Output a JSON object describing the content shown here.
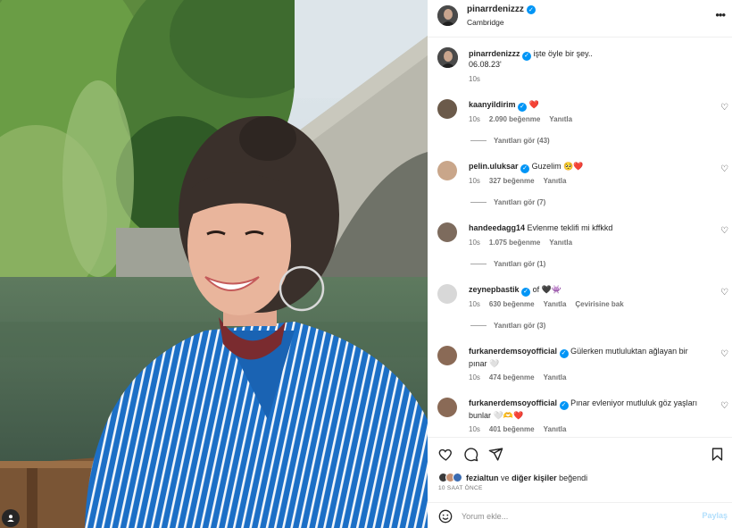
{
  "header": {
    "username": "pinarrdenizzz",
    "location": "Cambridge",
    "more_icon": "more-horizontal-icon"
  },
  "caption": {
    "username": "pinarrdenizzz",
    "text": "işte öyle bir şey..",
    "date_line": "06.08.23'",
    "time": "10s"
  },
  "comments": [
    {
      "username": "kaanyildirim",
      "verified": true,
      "text": "",
      "emoji": "❤️",
      "time": "10s",
      "likes": "2.090 beğenme",
      "reply": "Yanıtla",
      "translate": "",
      "view_replies": "Yanıtları gör (43)",
      "avatar_color": "#6b5a4a"
    },
    {
      "username": "pelin.uluksar",
      "verified": true,
      "text": "Guzelim",
      "emoji": "🥺❤️",
      "time": "10s",
      "likes": "327 beğenme",
      "reply": "Yanıtla",
      "translate": "",
      "view_replies": "Yanıtları gör (7)",
      "avatar_color": "#c9a68a"
    },
    {
      "username": "handeedagg14",
      "verified": false,
      "text": "Evlenme teklifi mi kffkkd",
      "emoji": "",
      "time": "10s",
      "likes": "1.075 beğenme",
      "reply": "Yanıtla",
      "translate": "",
      "view_replies": "Yanıtları gör (1)",
      "avatar_color": "#7d6b5d"
    },
    {
      "username": "zeynepbastik",
      "verified": true,
      "text": "of",
      "emoji": "🖤👾",
      "time": "10s",
      "likes": "630 beğenme",
      "reply": "Yanıtla",
      "translate": "Çevirisine bak",
      "view_replies": "Yanıtları gör (3)",
      "avatar_color": "#d8d8d8"
    },
    {
      "username": "furkanerdemsoyofficial",
      "verified": true,
      "text": "Gülerken mutluluktan ağlayan bir pınar",
      "emoji": "🤍",
      "time": "10s",
      "likes": "474 beğenme",
      "reply": "Yanıtla",
      "translate": "",
      "view_replies": "",
      "avatar_color": "#8a6a56"
    },
    {
      "username": "furkanerdemsoyofficial",
      "verified": true,
      "text": "Pınar evleniyor mutluluk göz yaşları bunlar",
      "emoji": "🤍🫶❤️",
      "time": "10s",
      "likes": "401 beğenme",
      "reply": "Yanıtla",
      "translate": "",
      "view_replies": "",
      "avatar_color": "#8a6a56"
    }
  ],
  "actions": {
    "like_icon": "heart-icon",
    "comment_icon": "comment-icon",
    "share_icon": "send-icon",
    "save_icon": "bookmark-icon"
  },
  "likes": {
    "first_user": "fezialtun",
    "connector": "ve",
    "others": "diğer kişiler",
    "suffix": "beğendi"
  },
  "time_ago": "10 SAAT ÖNCE",
  "add_comment": {
    "placeholder": "Yorum ekle...",
    "post_label": "Paylaş"
  },
  "colors": {
    "verified": "#0095f6",
    "heart": "#ed4956",
    "post_disabled": "#b2dffc",
    "shirt": "#1a6fc4"
  }
}
